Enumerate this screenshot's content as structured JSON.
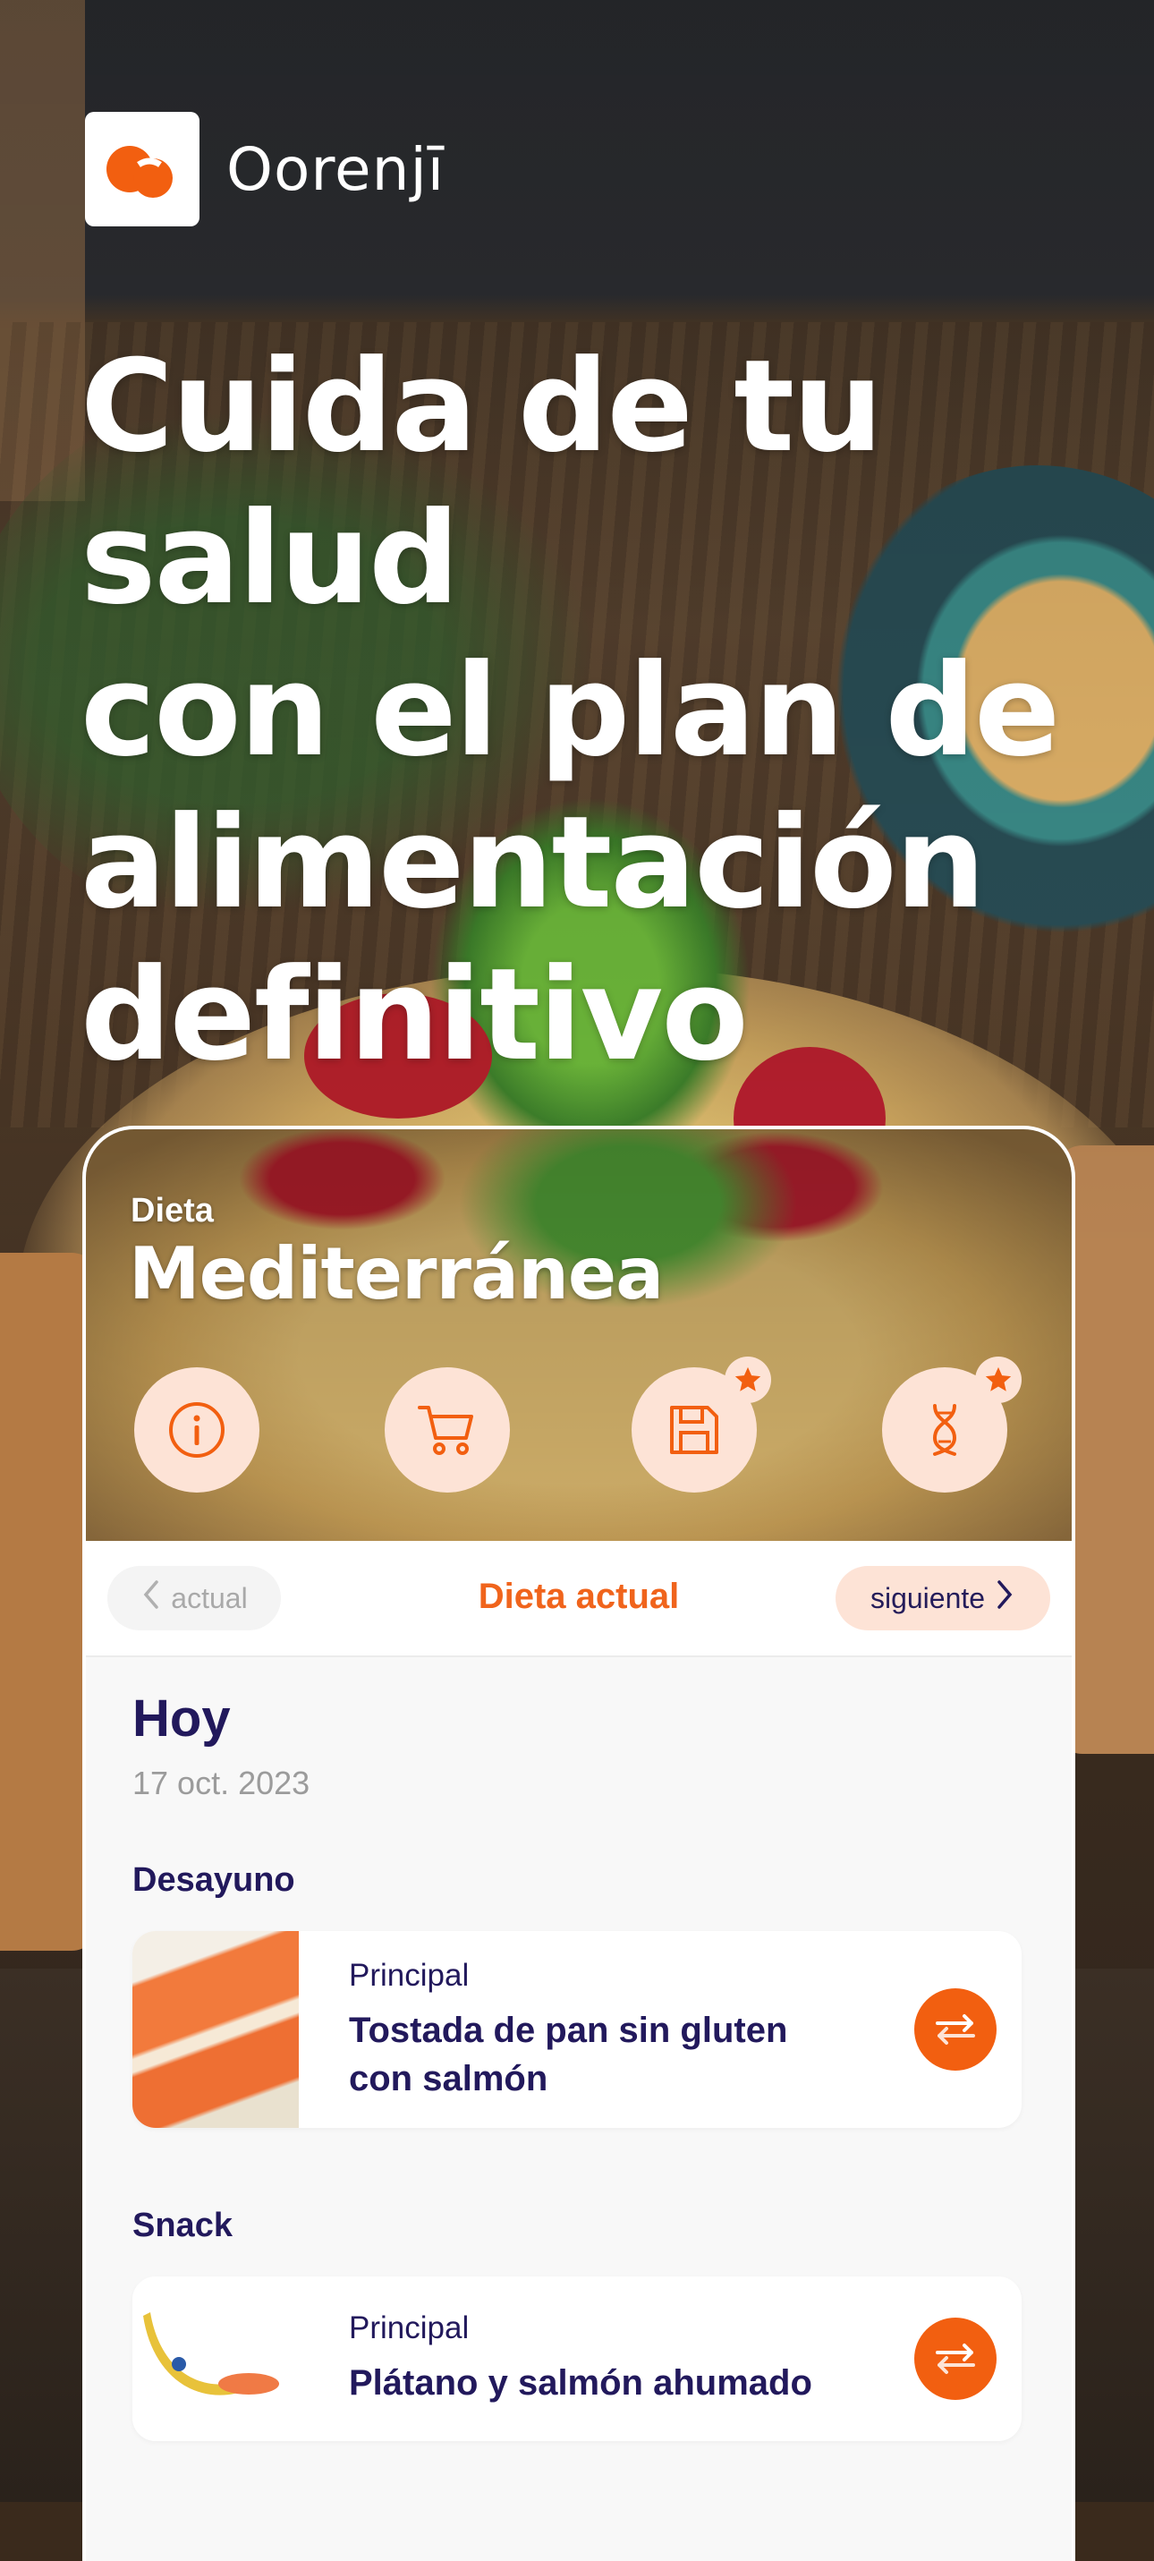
{
  "brand": {
    "name": "Oorenjī",
    "accent": "#F25F10",
    "accent_light": "#FDE3D6",
    "text_dark": "#22195C"
  },
  "hero": {
    "lines": [
      "Cuida de tu salud",
      "con el plan de",
      "alimentación",
      "definitivo"
    ]
  },
  "diet_card": {
    "label": "Dieta",
    "name": "Mediterránea",
    "actions": [
      {
        "icon": "info-icon",
        "badge": false
      },
      {
        "icon": "cart-icon",
        "badge": false
      },
      {
        "icon": "save-icon",
        "badge": true,
        "badge_icon": "star-icon"
      },
      {
        "icon": "dna-icon",
        "badge": true,
        "badge_icon": "star-icon"
      }
    ]
  },
  "nav": {
    "prev_label": "actual",
    "title": "Dieta actual",
    "next_label": "siguiente"
  },
  "day": {
    "title": "Hoy",
    "date": "17 oct. 2023",
    "meals": [
      {
        "section": "Desayuno",
        "type": "Principal",
        "name": "Tostada de pan sin gluten con salmón",
        "image": "salmon-toast-image"
      },
      {
        "section": "Snack",
        "type": "Principal",
        "name": "Plátano y salmón ahumado",
        "image": "banana-salmon-image"
      }
    ]
  }
}
